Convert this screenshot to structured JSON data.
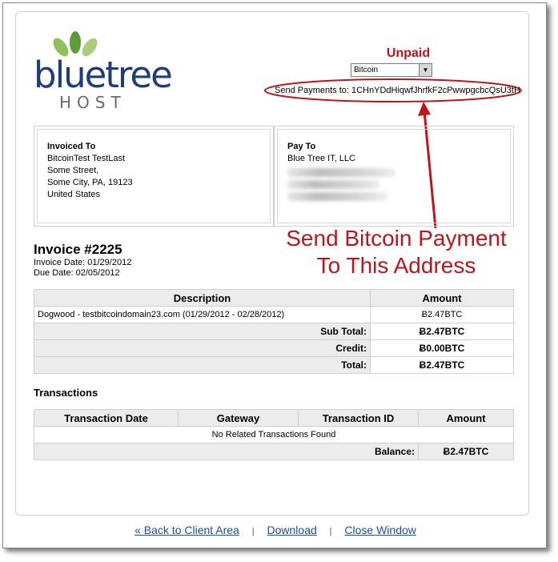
{
  "logo": {
    "word": "bluetree",
    "sub": "HOST"
  },
  "status": "Unpaid",
  "payment_method": {
    "selected": "Bitcoin"
  },
  "send_payments": "Send Payments to:  1CHnYDdHiqwfJhrfkF2cPwwpgcbcQsU3tH",
  "invoiced_to": {
    "label": "Invoiced To",
    "name": "BitcoinTest TestLast",
    "street": "Some Street,",
    "city": "Some City, PA, 19123",
    "country": "United States"
  },
  "pay_to": {
    "label": "Pay To",
    "company": "Blue Tree IT, LLC"
  },
  "annotation": {
    "line1": "Send Bitcoin Payment",
    "line2": "To This Address"
  },
  "invoice": {
    "title": "Invoice #2225",
    "invoice_date": "Invoice Date: 01/29/2012",
    "due_date": "Due Date: 02/05/2012"
  },
  "items_table": {
    "headers": {
      "description": "Description",
      "amount": "Amount"
    },
    "rows": [
      {
        "description": "Dogwood - testbitcoindomain23.com (01/29/2012 - 02/28/2012)",
        "amount": "Ƀ2.47BTC"
      }
    ],
    "sub_total": {
      "label": "Sub Total:",
      "value": "Ƀ2.47BTC"
    },
    "credit": {
      "label": "Credit:",
      "value": "Ƀ0.00BTC"
    },
    "total": {
      "label": "Total:",
      "value": "Ƀ2.47BTC"
    }
  },
  "transactions": {
    "title": "Transactions",
    "headers": {
      "date": "Transaction Date",
      "gateway": "Gateway",
      "id": "Transaction ID",
      "amount": "Amount"
    },
    "empty": "No Related Transactions Found",
    "balance": {
      "label": "Balance:",
      "value": "Ƀ2.47BTC"
    }
  },
  "footer": {
    "back": "« Back to Client Area",
    "sep": "|",
    "download": "Download",
    "close": "Close Window"
  },
  "colors": {
    "accent_red": "#c0141c",
    "brand_blue": "#1f3d7a",
    "link": "#1a4fa8",
    "leaf_green": "#7aa84a"
  }
}
